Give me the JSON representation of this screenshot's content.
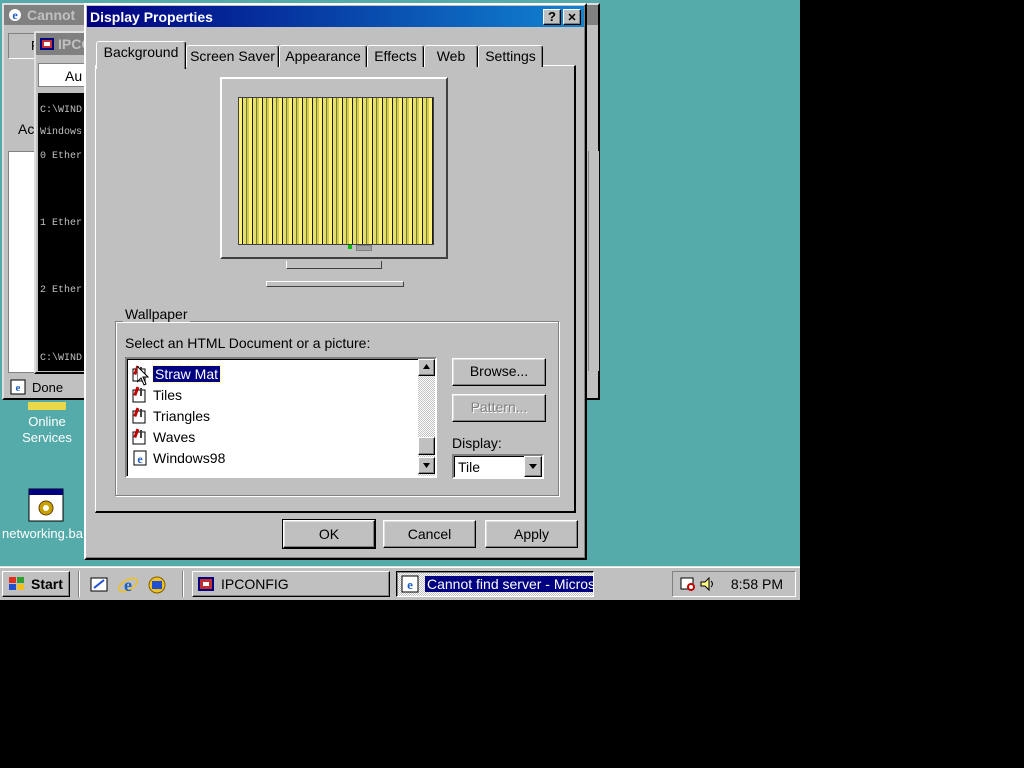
{
  "colors": {
    "desktop": "#55aaaa",
    "title_active": "#000080",
    "selection": "#000080"
  },
  "desktop": {
    "icons": [
      {
        "label_line1": "Online",
        "label_line2": "Services",
        "icon": "online-services-icon"
      },
      {
        "label_line1": "networking.ba",
        "label_line2": "",
        "icon": "batch-file-icon"
      }
    ]
  },
  "background_windows": {
    "browser": {
      "title": "Cannot",
      "status": "Done",
      "address_fragment": "Au",
      "address_label_fragment": "Ac",
      "menu_fragment": "F"
    },
    "console": {
      "title": "IPCO",
      "lines": [
        "C:\\WIND",
        "Windows",
        "0 Ether",
        "1 Ether",
        "2 Ether",
        "C:\\WIND"
      ]
    }
  },
  "dialog": {
    "title": "Display Properties",
    "help_label": "?",
    "close_label": "✕",
    "tabs": [
      {
        "label": "Background",
        "selected": true
      },
      {
        "label": "Screen Saver",
        "selected": false
      },
      {
        "label": "Appearance",
        "selected": false
      },
      {
        "label": "Effects",
        "selected": false
      },
      {
        "label": "Web",
        "selected": false
      },
      {
        "label": "Settings",
        "selected": false
      }
    ],
    "wallpaper": {
      "group_label": "Wallpaper",
      "prompt": "Select an HTML Document or a picture:",
      "items": [
        {
          "label": "Straw Mat",
          "selected": true,
          "icon": "paint-bitmap-icon"
        },
        {
          "label": "Tiles",
          "selected": false,
          "icon": "paint-bitmap-icon"
        },
        {
          "label": "Triangles",
          "selected": false,
          "icon": "paint-bitmap-icon"
        },
        {
          "label": "Waves",
          "selected": false,
          "icon": "paint-bitmap-icon"
        },
        {
          "label": "Windows98",
          "selected": false,
          "icon": "html-document-icon"
        }
      ],
      "browse_label": "Browse...",
      "pattern_label": "Pattern...",
      "display_label": "Display:",
      "display_value": "Tile"
    },
    "ok_label": "OK",
    "cancel_label": "Cancel",
    "apply_label": "Apply"
  },
  "taskbar": {
    "start_label": "Start",
    "quick_launch": [
      "show-desktop-icon",
      "internet-explorer-icon",
      "channels-icon"
    ],
    "tasks": [
      {
        "label": "IPCONFIG",
        "active": false
      },
      {
        "label": "Cannot find server - Micros...",
        "active": true
      }
    ],
    "clock": "8:58 PM"
  }
}
